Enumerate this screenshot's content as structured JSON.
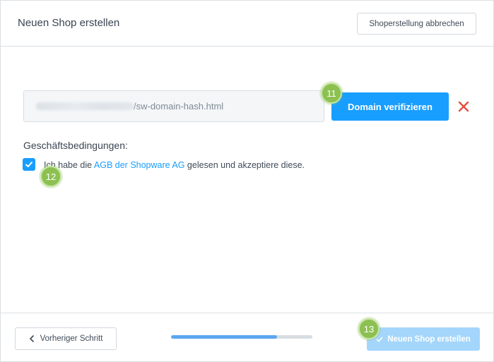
{
  "header": {
    "title": "Neuen Shop erstellen",
    "cancel_label": "Shoperstellung abbrechen"
  },
  "domain": {
    "input_suffix": "/sw-domain-hash.html",
    "verify_label": "Domain verifizieren"
  },
  "terms": {
    "heading": "Geschäftsbedingungen:",
    "checked": true,
    "text_before": "Ich habe die ",
    "link_text": "AGB der Shopware AG",
    "text_after": " gelesen und akzeptiere diese."
  },
  "footer": {
    "prev_label": "Vorheriger Schritt",
    "progress": 0.75,
    "create_label": "Neuen Shop erstellen"
  },
  "badges": [
    "11",
    "12",
    "13"
  ],
  "colors": {
    "primary": "#189eff",
    "disabled_primary": "#a4d6fc",
    "badge": "#8cc152",
    "danger": "#e74c3c"
  }
}
